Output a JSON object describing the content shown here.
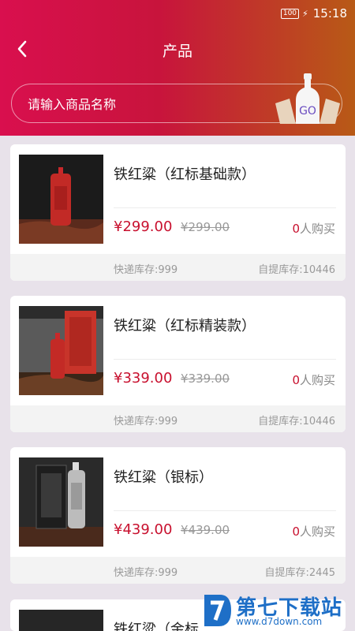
{
  "status": {
    "battery": "100",
    "time": "15:18"
  },
  "header": {
    "title": "产品"
  },
  "search": {
    "placeholder": "请输入商品名称",
    "go_label": "GO"
  },
  "colors": {
    "accent": "#c8102e",
    "header_start": "#d90f4e",
    "header_end": "#b85a16"
  },
  "products": [
    {
      "name": "铁红粱（红标基础款）",
      "price": "¥299.00",
      "original_price": "¥299.00",
      "buyers_count": "0",
      "buyers_suffix": "人购买",
      "express_stock": "快递库存:999",
      "pickup_stock": "自提库存:10446"
    },
    {
      "name": "铁红粱（红标精装款）",
      "price": "¥339.00",
      "original_price": "¥339.00",
      "buyers_count": "0",
      "buyers_suffix": "人购买",
      "express_stock": "快递库存:999",
      "pickup_stock": "自提库存:10446"
    },
    {
      "name": "铁红粱（银标）",
      "price": "¥439.00",
      "original_price": "¥439.00",
      "buyers_count": "0",
      "buyers_suffix": "人购买",
      "express_stock": "快递库存:999",
      "pickup_stock": "自提库存:2445"
    },
    {
      "name": "铁红粱（金标"
    }
  ],
  "watermark": {
    "title": "第七下载站",
    "url": "www.d7down.com"
  }
}
